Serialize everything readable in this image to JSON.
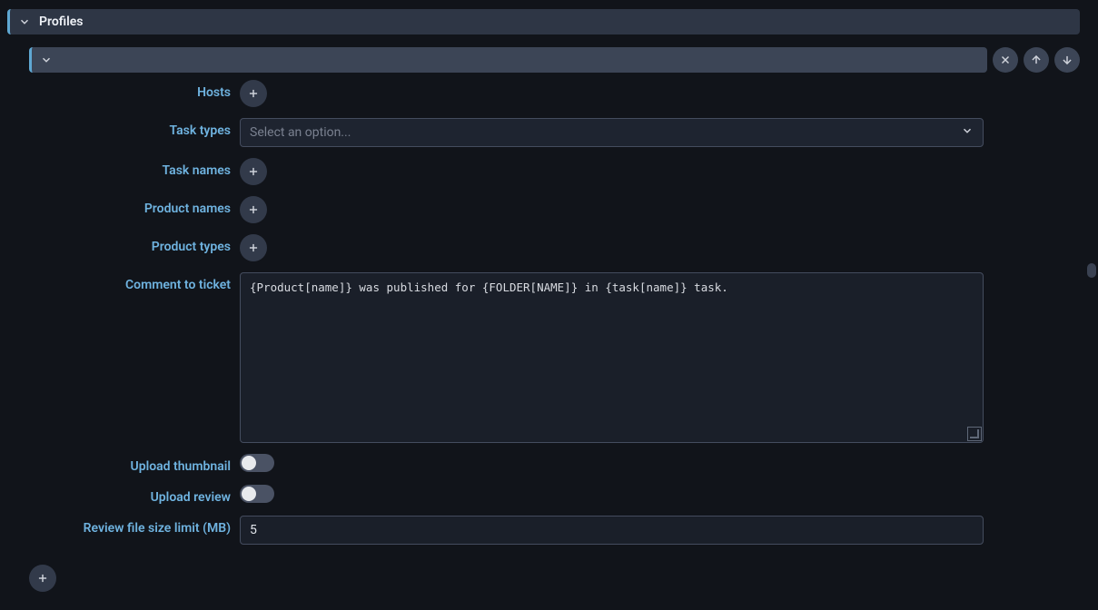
{
  "section": {
    "title": "Profiles"
  },
  "form": {
    "hosts_label": "Hosts",
    "task_types_label": "Task types",
    "task_types_placeholder": "Select an option...",
    "task_names_label": "Task names",
    "product_names_label": "Product names",
    "product_types_label": "Product types",
    "comment_label": "Comment to ticket",
    "comment_value": "{Product[name]} was published for {FOLDER[NAME]} in {task[name]} task.",
    "upload_thumbnail_label": "Upload thumbnail",
    "upload_thumbnail_value": false,
    "upload_review_label": "Upload review",
    "upload_review_value": false,
    "review_limit_label": "Review file size limit (MB)",
    "review_limit_value": "5"
  }
}
